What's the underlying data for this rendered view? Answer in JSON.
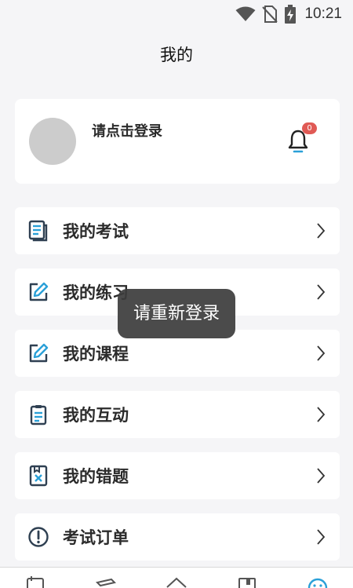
{
  "status_bar": {
    "time": "10:21"
  },
  "header": {
    "title": "我的"
  },
  "profile": {
    "login_prompt": "请点击登录",
    "notification_count": "0"
  },
  "menu": {
    "items": [
      {
        "label": "我的考试",
        "icon": "exam-list-icon"
      },
      {
        "label": "我的练习",
        "icon": "edit-icon"
      },
      {
        "label": "我的课程",
        "icon": "edit-icon"
      },
      {
        "label": "我的互动",
        "icon": "clipboard-icon"
      },
      {
        "label": "我的错题",
        "icon": "wrong-question-icon"
      },
      {
        "label": "考试订单",
        "icon": "info-circle-icon"
      }
    ]
  },
  "toast": {
    "message": "请重新登录"
  },
  "tab_bar": {
    "icons": [
      "document-icon",
      "pen-icon",
      "home-icon",
      "book-icon",
      "profile-icon"
    ],
    "active_color": "#2aa0d8"
  },
  "colors": {
    "icon_dark": "#2f4052",
    "icon_blue": "#2aa0d8",
    "badge": "#e05a55"
  }
}
